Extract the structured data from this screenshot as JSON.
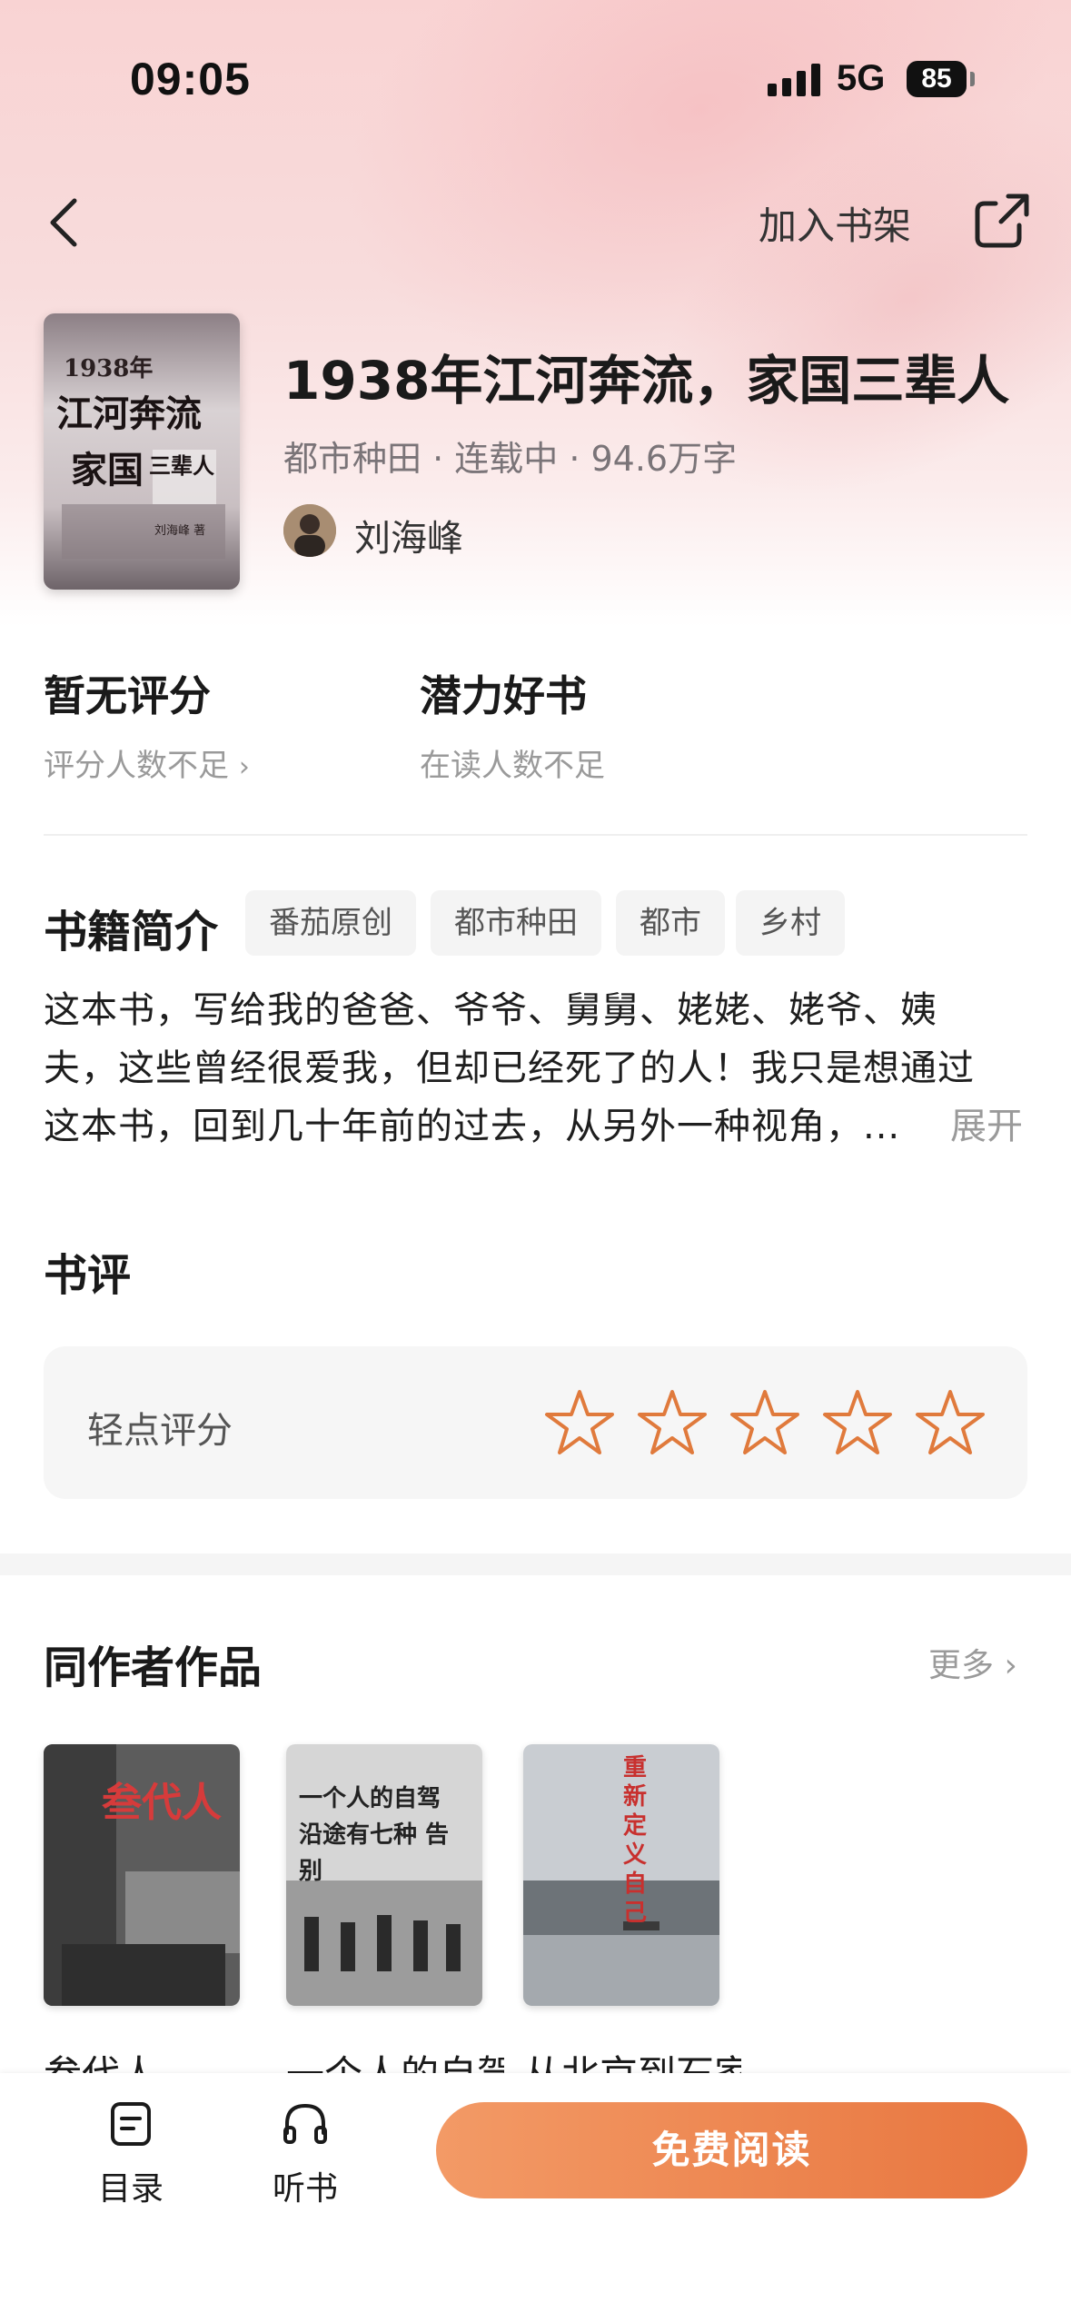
{
  "status_bar": {
    "time": "09:05",
    "network": "5G",
    "battery": "85"
  },
  "nav": {
    "add_to_shelf": "加入书架"
  },
  "book": {
    "title": "1938年江河奔流，家国三辈人",
    "meta": "都市种田 · 连载中 · 94.6万字",
    "author": "刘海峰",
    "cover_text": {
      "year": "1938年",
      "line1": "江河奔流",
      "line2": "家国",
      "line2_small": "三辈人",
      "author": "刘海峰  著"
    }
  },
  "stats": {
    "rating_title": "暂无评分",
    "rating_sub": "评分人数不足",
    "badge_title": "潜力好书",
    "badge_sub": "在读人数不足"
  },
  "intro": {
    "title": "书籍简介",
    "tags": [
      "番茄原创",
      "都市种田",
      "都市",
      "乡村"
    ],
    "lines": [
      "这本书，写给我的爸爸、爷爷、舅舅、姥姥、姥爷、姨",
      "夫，这些曾经很爱我，但却已经死了的人！我只是想通过",
      "这本书，回到几十年前的过去，从另外一种视角，..."
    ],
    "expand": "展开"
  },
  "review": {
    "title": "书评",
    "label": "轻点评分",
    "stars": 5,
    "star_color": "#e07a3c"
  },
  "same_author": {
    "title": "同作者作品",
    "more": "更多",
    "works": [
      {
        "title": "叁代人",
        "cover_text": "叁代人"
      },
      {
        "title": "一个人的自驾",
        "cover_text": "一个人的自驾 沿途有七种 告别"
      },
      {
        "title": "从北京到石家庄",
        "cover_text": "重新定义自己"
      }
    ]
  },
  "bottom": {
    "toc": "目录",
    "listen": "听书",
    "read": "免费阅读"
  },
  "colors": {
    "accent": "#e8763f",
    "hero_bg": "#f9d3d3"
  }
}
